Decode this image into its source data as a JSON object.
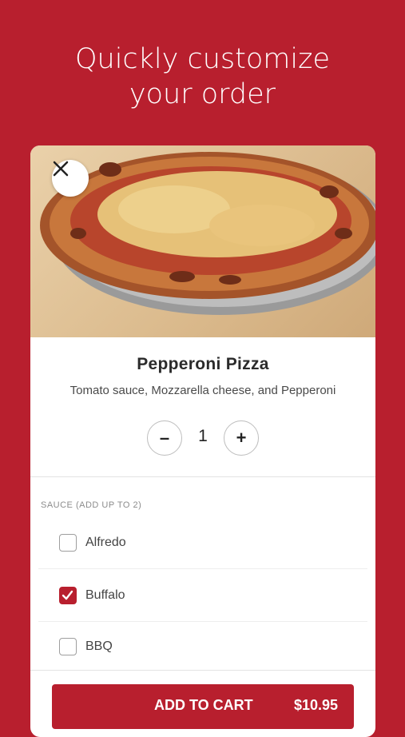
{
  "headline": {
    "line1": "Quickly customize",
    "line2": "your order"
  },
  "item": {
    "title": "Pepperoni Pizza",
    "description": "Tomato sauce, Mozzarella cheese, and Pepperoni"
  },
  "quantity": {
    "value": "1",
    "minus": "–",
    "plus": "+"
  },
  "section": {
    "label": "SAUCE (ADD UP TO 2)"
  },
  "options": [
    {
      "label": "Alfredo",
      "checked": false
    },
    {
      "label": "Buffalo",
      "checked": true
    },
    {
      "label": "BBQ",
      "checked": false
    }
  ],
  "cart": {
    "label": "ADD TO CART",
    "price": "$10.95"
  },
  "colors": {
    "brand": "#b81f2e"
  },
  "icons": {
    "close": "close-icon",
    "check": "checkmark-icon"
  }
}
